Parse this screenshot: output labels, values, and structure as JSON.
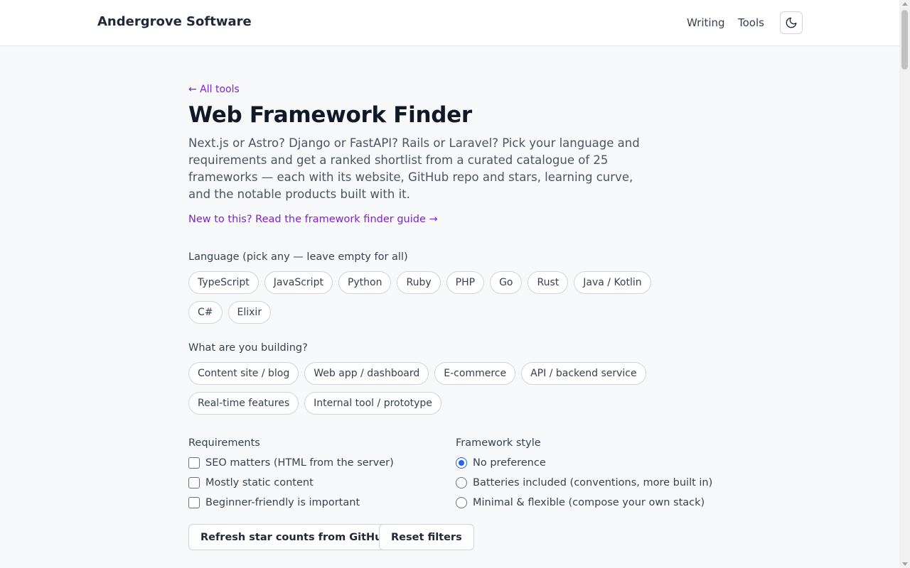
{
  "header": {
    "brand": "Andergrove Software",
    "nav": [
      {
        "label": "Writing"
      },
      {
        "label": "Tools"
      }
    ],
    "theme_icon": "moon-icon"
  },
  "page": {
    "back_link": "← All tools",
    "title": "Web Framework Finder",
    "intro": "Next.js or Astro? Django or FastAPI? Rails or Laravel? Pick your language and requirements and get a ranked shortlist from a curated catalogue of 25 frameworks — each with its website, GitHub repo and stars, learning curve, and the notable products built with it.",
    "guide_link": "New to this? Read the framework finder guide →"
  },
  "language": {
    "label": "Language (pick any — leave empty for all)",
    "options": [
      "TypeScript",
      "JavaScript",
      "Python",
      "Ruby",
      "PHP",
      "Go",
      "Rust",
      "Java / Kotlin",
      "C#",
      "Elixir"
    ]
  },
  "building": {
    "label": "What are you building?",
    "options": [
      "Content site / blog",
      "Web app / dashboard",
      "E-commerce",
      "API / backend service",
      "Real-time features",
      "Internal tool / prototype"
    ]
  },
  "requirements": {
    "label": "Requirements",
    "options": [
      {
        "label": "SEO matters (HTML from the server)",
        "checked": false
      },
      {
        "label": "Mostly static content",
        "checked": false
      },
      {
        "label": "Beginner-friendly is important",
        "checked": false
      }
    ]
  },
  "style": {
    "label": "Framework style",
    "options": [
      {
        "label": "No preference",
        "checked": true
      },
      {
        "label": "Batteries included (conventions, more built in)",
        "checked": false
      },
      {
        "label": "Minimal & flexible (compose your own stack)",
        "checked": false
      }
    ]
  },
  "actions": {
    "refresh": "Refresh star counts from GitHub",
    "reset": "Reset filters"
  },
  "colors": {
    "accent": "#7e22ce",
    "radio_selected": "#2563eb"
  }
}
